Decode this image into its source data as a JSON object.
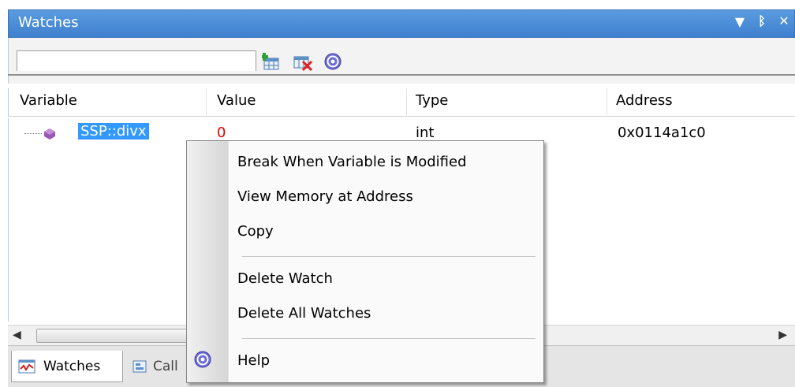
{
  "window": {
    "title": "Watches",
    "controls": {
      "menu": "▼",
      "pin": "ᛒ",
      "close": "✕"
    }
  },
  "toolbar": {
    "search_value": "",
    "add_icon": "add-watch-icon",
    "delete_icon": "delete-watch-icon",
    "help_icon": "help-icon"
  },
  "columns": [
    "Variable",
    "Value",
    "Type",
    "Address"
  ],
  "rows": [
    {
      "variable": "SSP::divx",
      "value": "0",
      "type": "int",
      "address": "0x0114a1c0"
    }
  ],
  "context_menu": {
    "items": [
      "Break When Variable is Modified",
      "View Memory at Address",
      "Copy",
      "Delete Watch",
      "Delete All Watches",
      "Help"
    ]
  },
  "tabs": [
    {
      "label": "Watches",
      "active": true
    },
    {
      "label": "Call",
      "active": false
    }
  ],
  "colors": {
    "title_bar": "#4a8ad6",
    "selection": "#3399ff",
    "value_text": "#e00000"
  }
}
